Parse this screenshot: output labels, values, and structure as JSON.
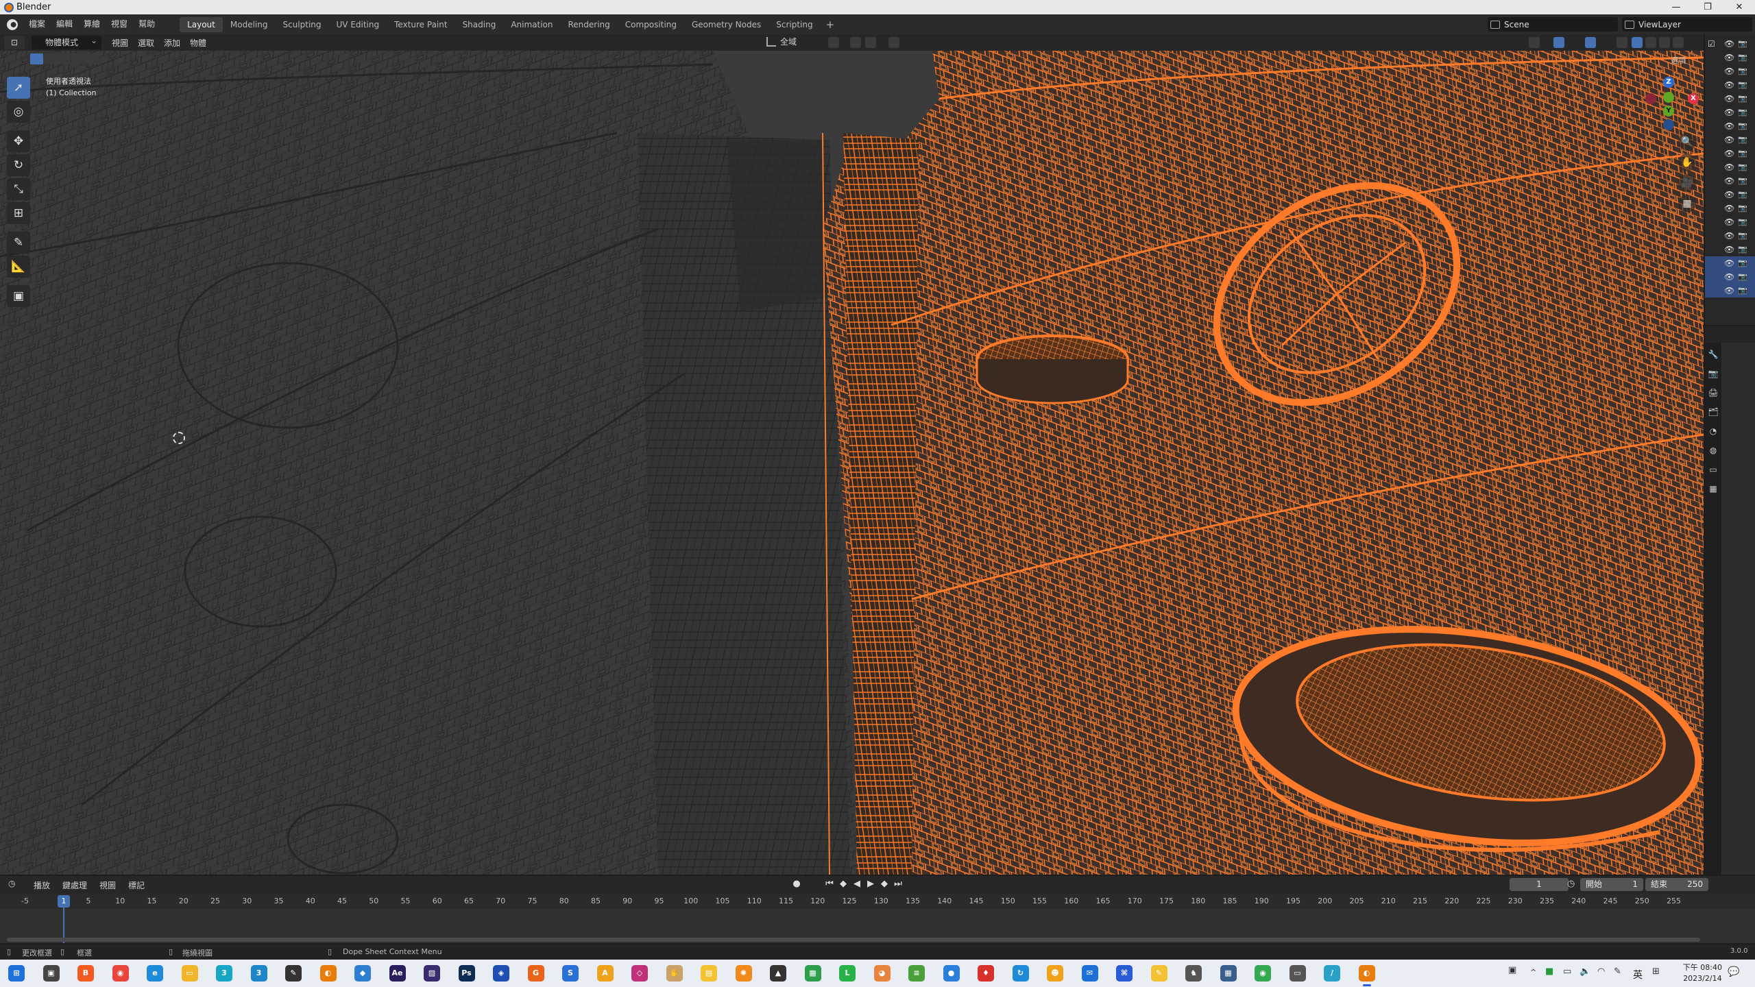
{
  "window": {
    "title": "Blender",
    "controls": [
      "—",
      "❐",
      "✕"
    ]
  },
  "topbar": {
    "menu": [
      "檔案",
      "編輯",
      "算繪",
      "視窗",
      "幫助"
    ],
    "workspaces": [
      "Layout",
      "Modeling",
      "Sculpting",
      "UV Editing",
      "Texture Paint",
      "Shading",
      "Animation",
      "Rendering",
      "Compositing",
      "Geometry Nodes",
      "Scripting"
    ],
    "active_workspace": "Layout",
    "add_workspace": "+",
    "scene": "Scene",
    "view_layer": "ViewLayer"
  },
  "viewport_header": {
    "mode": "物體模式",
    "menu": [
      "視圖",
      "選取",
      "添加",
      "物體"
    ],
    "orientation": "全域",
    "options": "選項"
  },
  "viewport": {
    "info_line1": "使用者透視法",
    "info_line2": "(1) Collection",
    "gizmo": {
      "x": "X",
      "y": "Y",
      "z": "Z"
    },
    "nav_icons": [
      "zoom-icon",
      "hand-icon",
      "camera-icon",
      "grid-icon"
    ],
    "colors": {
      "background": "#3b3b3b",
      "wire_grey": "#2a2a2a",
      "selected_wire": "#ff7a29",
      "selected_fill": "#3a2b22"
    }
  },
  "toolbar": {
    "tools": [
      "select-box-tool",
      "cursor-tool",
      "move-tool",
      "rotate-tool",
      "scale-tool",
      "transform-tool",
      "annotate-tool",
      "measure-tool",
      "add-cube-tool"
    ]
  },
  "timeline": {
    "menu": [
      "播放",
      "鍵處理",
      "視圖",
      "標記"
    ],
    "current_frame": "1",
    "start_label": "開始",
    "start": "1",
    "end_label": "結束",
    "end": "250",
    "ticks": [
      "-5",
      "1",
      "5",
      "10",
      "15",
      "20",
      "25",
      "30",
      "35",
      "40",
      "45",
      "50",
      "55",
      "60",
      "65",
      "70",
      "75",
      "80",
      "85",
      "90",
      "95",
      "100",
      "105",
      "110",
      "115",
      "120",
      "125",
      "130",
      "135",
      "140",
      "145",
      "150",
      "155",
      "160",
      "165",
      "170",
      "175",
      "180",
      "185",
      "190",
      "195",
      "200",
      "205",
      "210",
      "215",
      "220",
      "225",
      "230",
      "235",
      "240",
      "245",
      "250",
      "255"
    ]
  },
  "statusbar": {
    "select_toggle": "更改框選",
    "pan": "框選",
    "rotate": "拖繞視圖",
    "context": "Dope Sheet Context Menu",
    "version": "3.0.0"
  },
  "taskbar": {
    "apps": [
      {
        "name": "windows-start-icon",
        "label": "⊞",
        "color": "#1f6fd8"
      },
      {
        "name": "task-view-icon",
        "label": "▣",
        "color": "#444444"
      },
      {
        "name": "brave-icon",
        "label": "B",
        "color": "#f25a1f"
      },
      {
        "name": "chrome-icon",
        "label": "◉",
        "color": "#e8453c"
      },
      {
        "name": "edge-icon",
        "label": "e",
        "color": "#1f8bd8"
      },
      {
        "name": "explorer-icon",
        "label": "▭",
        "color": "#f2b428"
      },
      {
        "name": "app-3-icon",
        "label": "3",
        "color": "#18a6c7"
      },
      {
        "name": "app-3b-icon",
        "label": "3",
        "color": "#1c86c9"
      },
      {
        "name": "inkscape-icon",
        "label": "✎",
        "color": "#333333"
      },
      {
        "name": "blender-alt-icon",
        "label": "◐",
        "color": "#e87d0d"
      },
      {
        "name": "app-diamond-icon",
        "label": "◆",
        "color": "#2f7fd1"
      },
      {
        "name": "after-effects-icon",
        "label": "Ae",
        "color": "#2a1d5c"
      },
      {
        "name": "premiere-icon",
        "label": "▨",
        "color": "#3a2a6e"
      },
      {
        "name": "photoshop-icon",
        "label": "Ps",
        "color": "#0d2c54"
      },
      {
        "name": "shield-app-icon",
        "label": "◈",
        "color": "#1d4fb3"
      },
      {
        "name": "app-g-icon",
        "label": "G",
        "color": "#e8641a"
      },
      {
        "name": "app-s-icon",
        "label": "S",
        "color": "#2a6fd6"
      },
      {
        "name": "app-a-icon",
        "label": "A",
        "color": "#f0a31a"
      },
      {
        "name": "app-gem-icon",
        "label": "◇",
        "color": "#c0307a"
      },
      {
        "name": "app-hand-icon",
        "label": "✋",
        "color": "#c9a267"
      },
      {
        "name": "app-note-icon",
        "label": "▤",
        "color": "#f2c233"
      },
      {
        "name": "app-sun-icon",
        "label": "✺",
        "color": "#f08a1a"
      },
      {
        "name": "app-bag-icon",
        "label": "▲",
        "color": "#333333"
      },
      {
        "name": "app-grid-icon",
        "label": "▦",
        "color": "#2e9e4d"
      },
      {
        "name": "line-icon",
        "label": "L",
        "color": "#27b24a"
      },
      {
        "name": "app-color-icon",
        "label": "◕",
        "color": "#e8843c"
      },
      {
        "name": "app-layers-icon",
        "label": "≡",
        "color": "#4aa03a"
      },
      {
        "name": "app-drop-icon",
        "label": "●",
        "color": "#2a7fd8"
      },
      {
        "name": "app-red-icon",
        "label": "♦",
        "color": "#d8302a"
      },
      {
        "name": "app-sync-icon",
        "label": "↻",
        "color": "#1f8bd8"
      },
      {
        "name": "app-face-icon",
        "label": "☻",
        "color": "#f0a31a"
      },
      {
        "name": "app-chat-icon",
        "label": "✉",
        "color": "#1f6fd8"
      },
      {
        "name": "app-map-icon",
        "label": "⌘",
        "color": "#2a5bd7"
      },
      {
        "name": "sticky-icon",
        "label": "✎",
        "color": "#f2c233"
      },
      {
        "name": "app-figure-icon",
        "label": "♞",
        "color": "#555555"
      },
      {
        "name": "calculator-icon",
        "label": "▦",
        "color": "#3a5f8a"
      },
      {
        "name": "chrome-alt-icon",
        "label": "◉",
        "color": "#34a853"
      },
      {
        "name": "app-cards-icon",
        "label": "▭",
        "color": "#555555"
      },
      {
        "name": "app-pen-icon",
        "label": "/",
        "color": "#2aa0c8"
      },
      {
        "name": "blender-icon",
        "label": "◐",
        "color": "#e87d0d",
        "active": true
      }
    ],
    "language": "英",
    "time": "下午 08:40",
    "date": "2023/2/14"
  }
}
